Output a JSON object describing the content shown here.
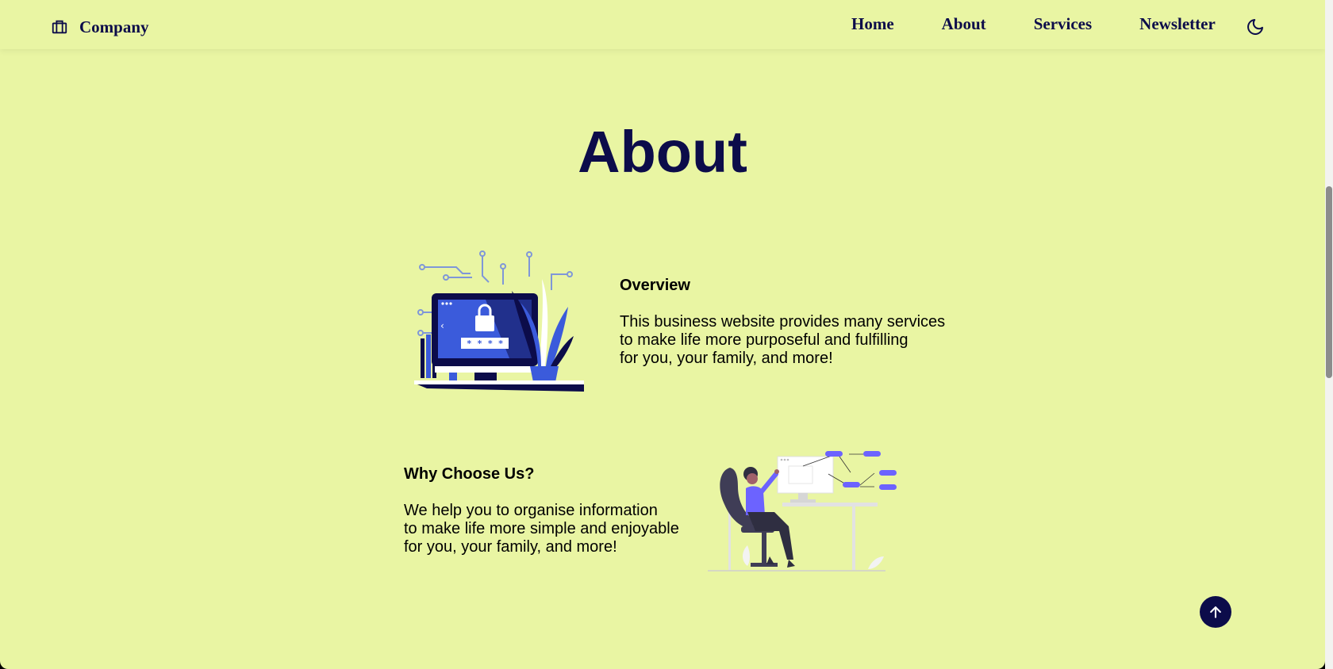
{
  "header": {
    "brand_name": "Company",
    "brand_icon": "briefcase-icon",
    "nav": [
      {
        "label": "Home"
      },
      {
        "label": "About"
      },
      {
        "label": "Services"
      },
      {
        "label": "Newsletter"
      }
    ],
    "theme_icon": "moon-icon"
  },
  "main": {
    "title": "About",
    "overview": {
      "heading": "Overview",
      "lines": [
        "This business website provides many services",
        "to make life more purposeful and fulfilling",
        "for you, your family, and more!"
      ],
      "illustration": "security-login-illustration"
    },
    "why": {
      "heading": "Why Choose Us?",
      "lines": [
        "We help you to organise information",
        "to make life more simple and enjoyable",
        "for you, your family, and more!"
      ],
      "illustration": "office-work-illustration"
    }
  },
  "back_to_top_icon": "arrow-up-icon",
  "colors": {
    "background": "#e9f5a3",
    "navy": "#0c0c4a",
    "blue": "#3b5bdb",
    "purple": "#6c63ff"
  }
}
